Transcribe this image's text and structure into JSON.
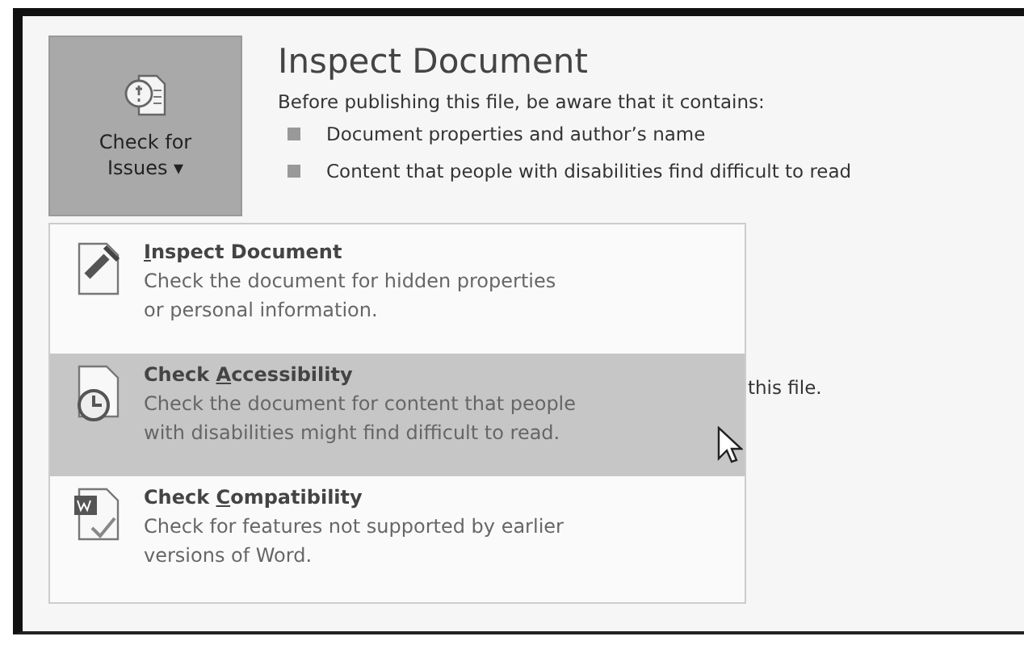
{
  "check_button": {
    "label_lines": [
      "Check for",
      "Issues"
    ],
    "caret": "▾"
  },
  "info": {
    "title": "Inspect Document",
    "intro": "Before publishing this file, be aware that it contains:",
    "bullets": [
      "Document properties and author’s name",
      "Content that people with disabilities find difficult to read"
    ],
    "partial_text": "this file."
  },
  "menu": [
    {
      "access_key": "I",
      "label_after": "nspect Document",
      "description": [
        "Check the document for hidden properties",
        "or personal information."
      ],
      "selected": false
    },
    {
      "label_before": "Check ",
      "access_key": "A",
      "label_after": "ccessibility",
      "description": [
        "Check the document for content that people",
        "with disabilities might find difficult to read."
      ],
      "selected": true
    },
    {
      "label_before": "Check ",
      "access_key": "C",
      "label_after": "ompatibility",
      "description": [
        "Check for features not supported by earlier",
        "versions of Word."
      ],
      "selected": false
    }
  ]
}
